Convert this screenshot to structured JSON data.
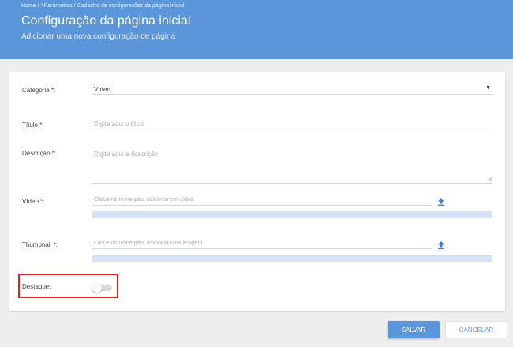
{
  "header": {
    "breadcrumb": "Home / >Parâmetros / Cadastro de configurações da página inicial",
    "title": "Configuração da página inicial",
    "subtitle": "Adicionar uma nova configuração de página"
  },
  "form": {
    "categoria": {
      "label": "Categoria *:",
      "value": "Vídeo",
      "icon": "caret-down-icon"
    },
    "titulo": {
      "label": "Título *:",
      "placeholder": "Digite aqui o título"
    },
    "descricao": {
      "label": "Descrição *:",
      "placeholder": "Digite aqui a descrição"
    },
    "video": {
      "label": "Vídeo *:",
      "placeholder": "Clique no ícone para adicionar um vídeo",
      "icon": "upload-icon",
      "progress": 0
    },
    "thumbnail": {
      "label": "Thumbnail *:",
      "placeholder": "Clique no ícone para adicionar uma imagem",
      "icon": "upload-icon",
      "progress": 0
    },
    "destaque": {
      "label": "Destaque:",
      "enabled": false
    }
  },
  "actions": {
    "save_label": "SALVAR",
    "cancel_label": "CANCELAR"
  },
  "colors": {
    "primary": "#5a96d9",
    "highlight": "#e02020",
    "progress_track": "#d6e3f4"
  }
}
